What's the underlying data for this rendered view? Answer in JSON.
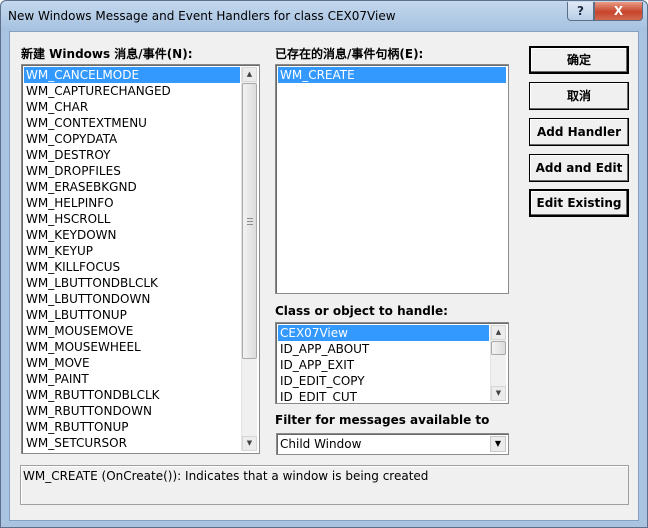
{
  "window": {
    "title": "New Windows Message and Event Handlers for class CEX07View",
    "help_label": "?",
    "close_label": "X"
  },
  "new_messages": {
    "label": "新建 Windows 消息/事件(N):",
    "items": [
      "WM_CANCELMODE",
      "WM_CAPTURECHANGED",
      "WM_CHAR",
      "WM_CONTEXTMENU",
      "WM_COPYDATA",
      "WM_DESTROY",
      "WM_DROPFILES",
      "WM_ERASEBKGND",
      "WM_HELPINFO",
      "WM_HSCROLL",
      "WM_KEYDOWN",
      "WM_KEYUP",
      "WM_KILLFOCUS",
      "WM_LBUTTONDBLCLK",
      "WM_LBUTTONDOWN",
      "WM_LBUTTONUP",
      "WM_MOUSEMOVE",
      "WM_MOUSEWHEEL",
      "WM_MOVE",
      "WM_PAINT",
      "WM_RBUTTONDBLCLK",
      "WM_RBUTTONDOWN",
      "WM_RBUTTONUP",
      "WM_SETCURSOR"
    ],
    "selected": "WM_CANCELMODE"
  },
  "existing_handlers": {
    "label": "已存在的消息/事件句柄(E):",
    "items": [
      "WM_CREATE"
    ],
    "selected": "WM_CREATE"
  },
  "class_objects": {
    "label": "Class or object to handle:",
    "items": [
      "CEX07View",
      "ID_APP_ABOUT",
      "ID_APP_EXIT",
      "ID_EDIT_COPY",
      "ID_EDIT_CUT"
    ],
    "selected": "CEX07View"
  },
  "filter": {
    "label": "Filter for messages available to",
    "value": "Child Window"
  },
  "buttons": {
    "ok": "确定",
    "cancel": "取消",
    "add_handler": "Add Handler",
    "add_and_edit": "Add and Edit",
    "edit_existing": "Edit Existing"
  },
  "status": {
    "text": "WM_CREATE (OnCreate()):  Indicates that a window is being created"
  },
  "colors": {
    "selection": "#3399ff",
    "dialog_bg": "#f0f0f0",
    "frame": "#a9c3e1",
    "close_button": "#c6452c"
  }
}
